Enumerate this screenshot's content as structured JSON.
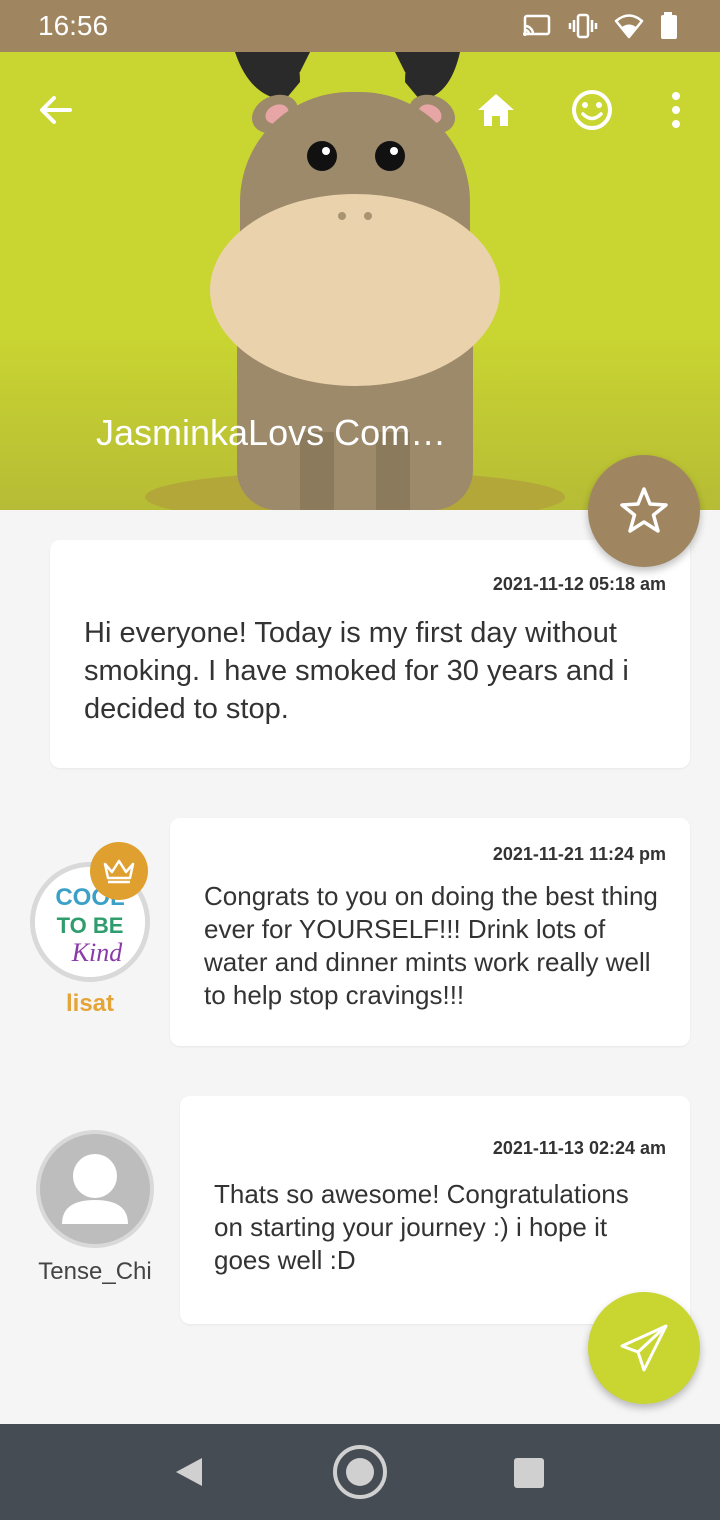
{
  "status_bar": {
    "time": "16:56",
    "icons": [
      "cast-icon",
      "vibrate-icon",
      "wifi-icon",
      "battery-icon"
    ]
  },
  "header": {
    "title": "JasminkaLovs Com…",
    "actions": [
      "back-arrow-icon",
      "home-icon",
      "smiley-icon",
      "more-vert-icon"
    ],
    "accent_color": "#c9d531",
    "brand_color": "#a08660"
  },
  "posts": [
    {
      "timestamp": "2021-11-12 05:18 am",
      "text": "Hi everyone! Today is my first day without smoking. I have smoked for 30 years and i decided to stop."
    },
    {
      "author": "lisat",
      "timestamp": "2021-11-21 11:24 pm",
      "text": "Congrats to you on doing the best thing ever for YOURSELF!!!  Drink lots of water and dinner mints work really well to help stop cravings!!!",
      "avatar_text": [
        "COOL",
        "TO BE",
        "Kind"
      ]
    },
    {
      "author": "Tense_Chi",
      "timestamp": "2021-11-13 02:24 am",
      "text": "Thats so awesome! Congratulations on starting your journey :) i hope it goes well :D"
    }
  ],
  "fab": {
    "favorite_icon": "star-outline-icon",
    "send_icon": "paper-plane-icon"
  },
  "nav_bar": {
    "buttons": [
      "nav-back-icon",
      "nav-home-icon",
      "nav-recents-icon"
    ]
  }
}
